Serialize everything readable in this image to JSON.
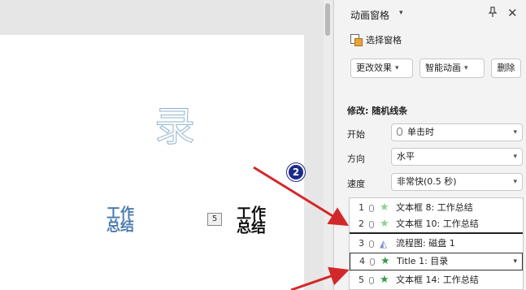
{
  "slide": {
    "big_char": "录",
    "blue_text_line1": "工作",
    "blue_text_line2": "总结",
    "tag": "5",
    "black_text_line1": "工作",
    "black_text_line2": "总结"
  },
  "pane": {
    "title": "动画窗格",
    "select_pane": "选择窗格",
    "buttons": {
      "effect": "更改效果",
      "smart": "智能动画",
      "delete": "删除"
    },
    "modify_label": "修改: 随机线条",
    "rows": {
      "start_label": "开始",
      "start_value": "单击时",
      "direction_label": "方向",
      "direction_value": "水平",
      "speed_label": "速度",
      "speed_value": "非常快(0.5 秒)"
    },
    "items": [
      {
        "num": "1",
        "label": "文本框 8: 工作总结"
      },
      {
        "num": "2",
        "label": "文本框 10: 工作总结"
      },
      {
        "num": "3",
        "label": "流程图: 磁盘 1"
      },
      {
        "num": "4",
        "label": "Title 1:  目录"
      },
      {
        "num": "5",
        "label": "文本框 14: 工作总结"
      }
    ]
  },
  "annotation": {
    "badge": "2"
  },
  "colors": {
    "arrow": "#d3282a",
    "badge": "#1c2a8a",
    "star_green": "#3a9a4a"
  }
}
